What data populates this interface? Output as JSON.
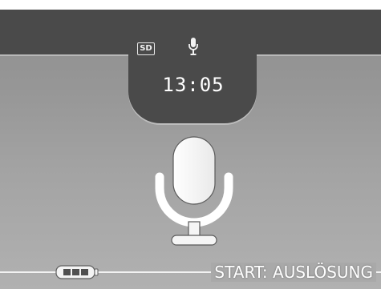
{
  "screen": {
    "mode": "voice-recording",
    "colors": {
      "background": "#9e9e9e",
      "panel": "#4a4a4a",
      "text": "#ffffff"
    }
  },
  "top_bar": {
    "media_badge": "SD",
    "mic_icon": "microphone-icon",
    "time": "13:05"
  },
  "center": {
    "icon": "microphone-icon"
  },
  "bottom_bar": {
    "battery_icon": "battery-full-icon",
    "battery_level": 1.0,
    "instruction": "START: AUSLÖSUNG"
  }
}
